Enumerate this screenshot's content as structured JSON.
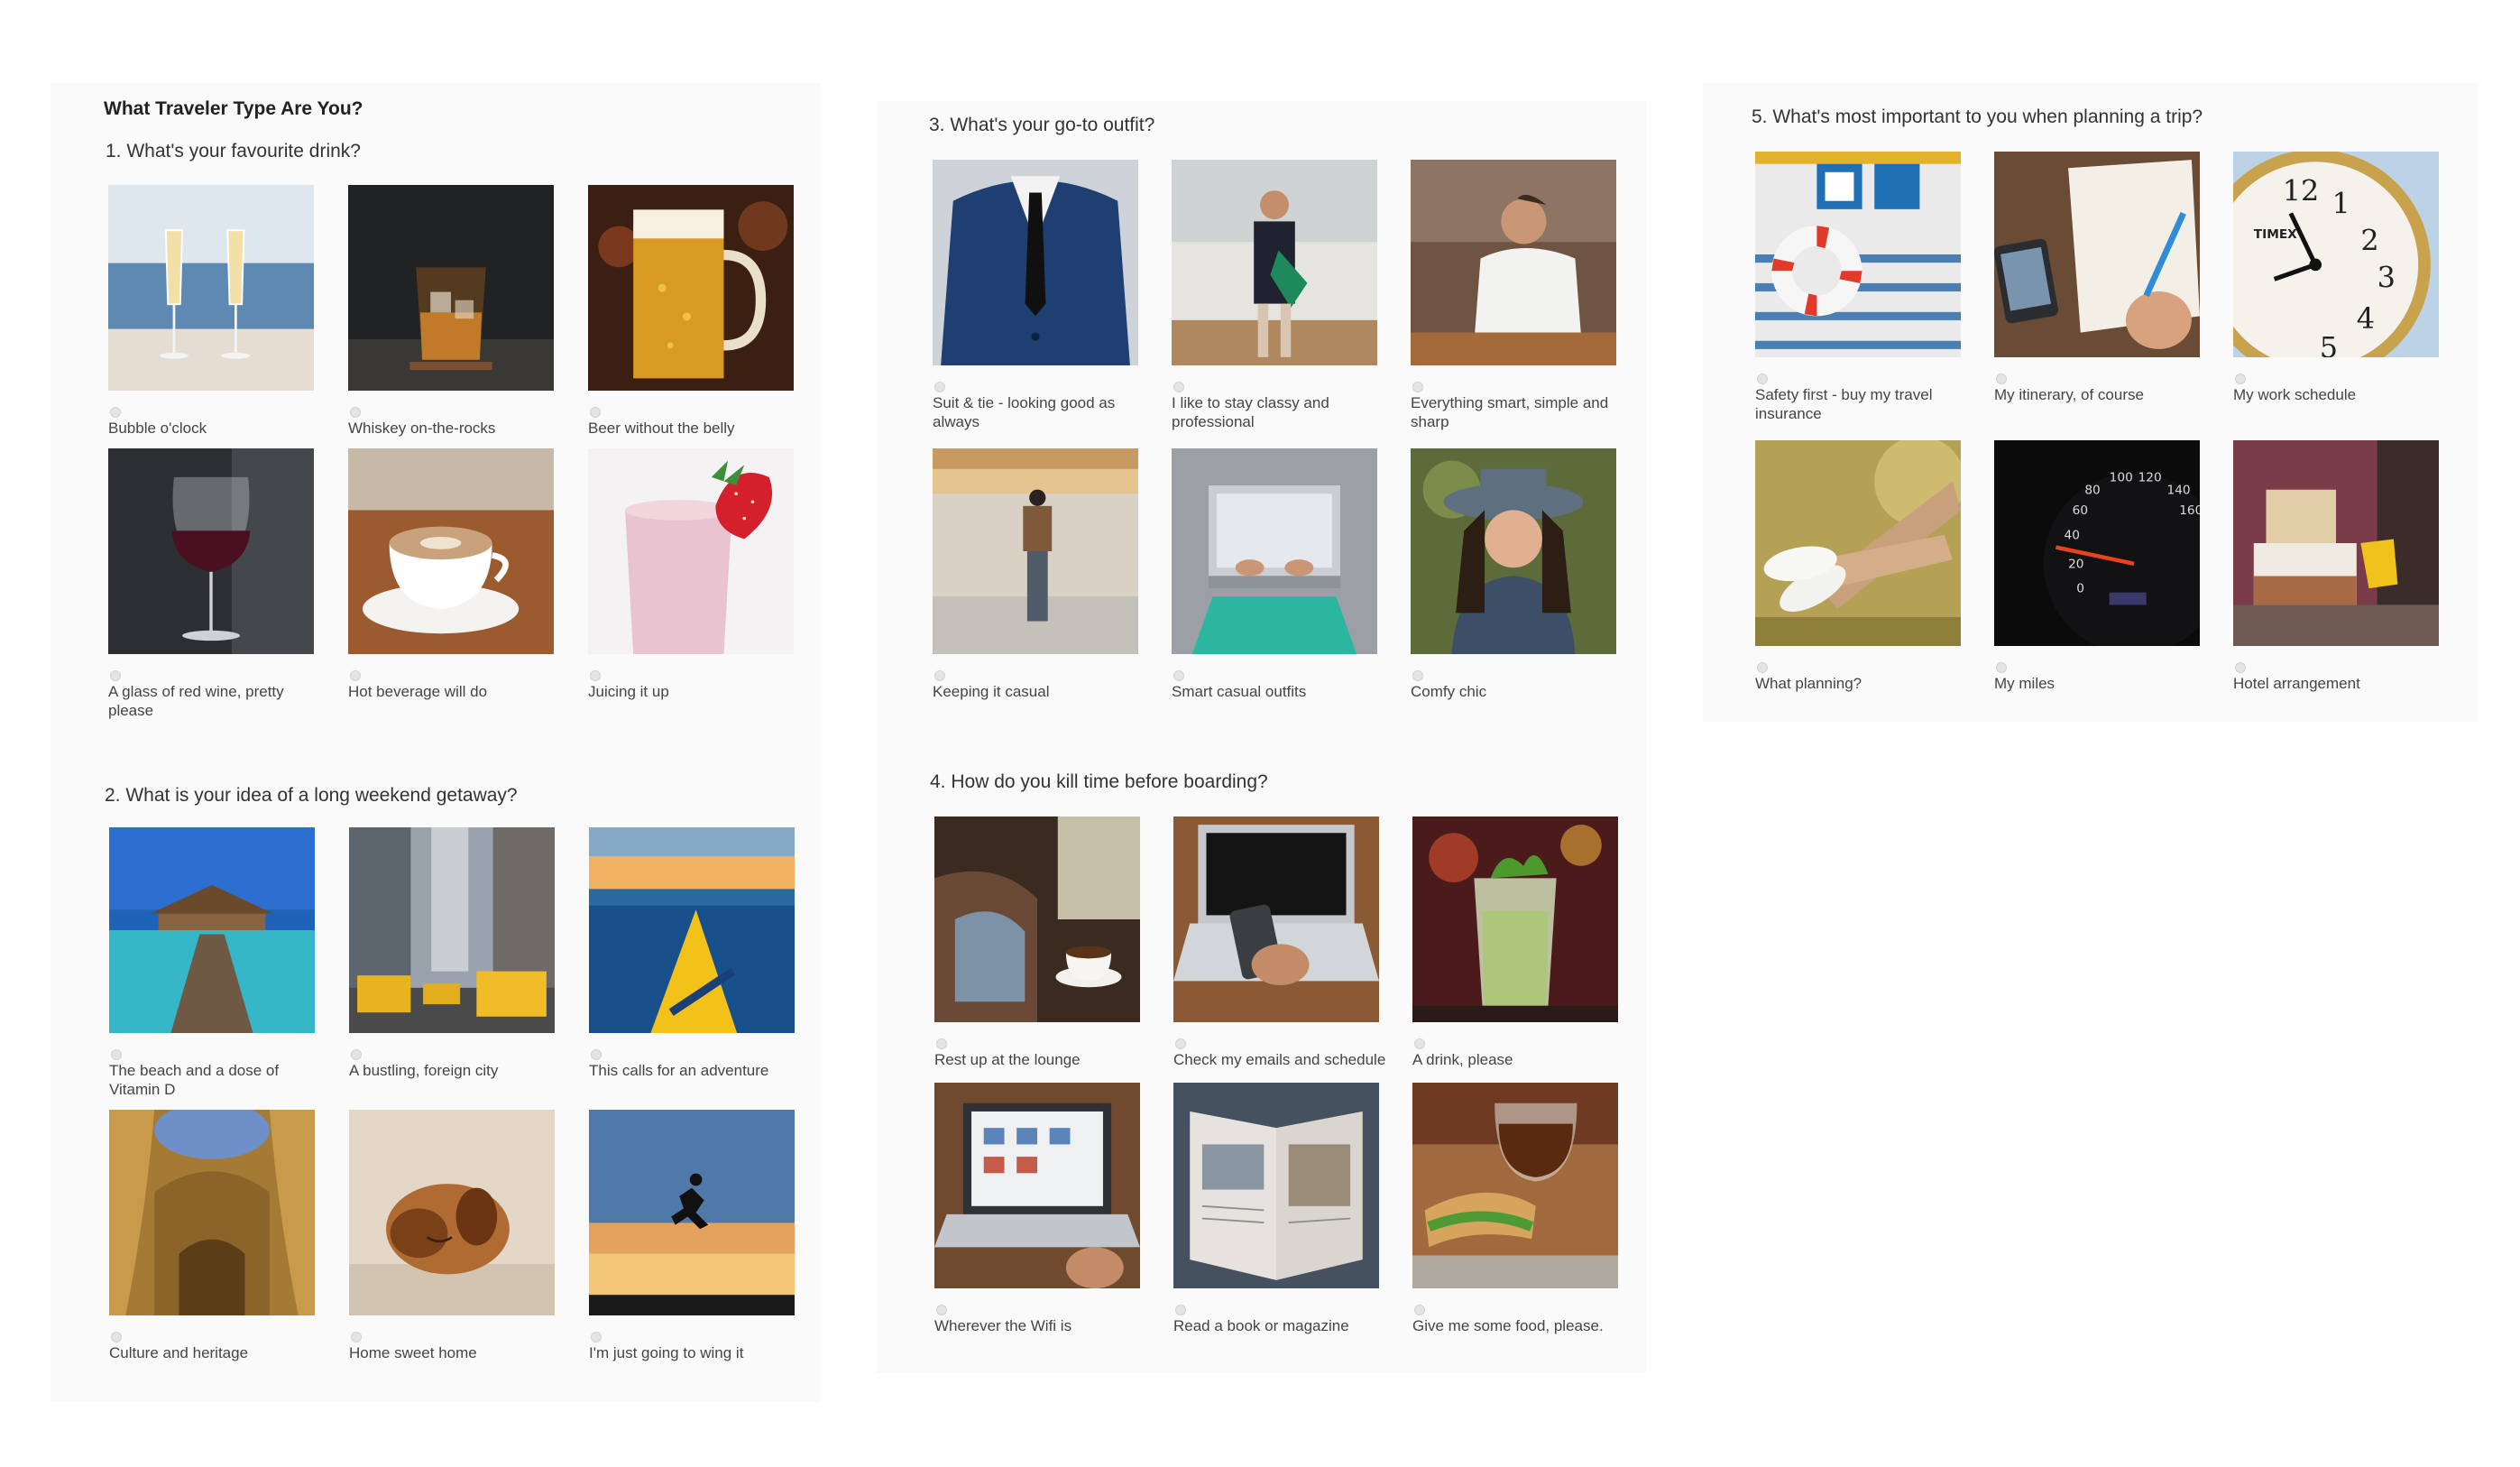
{
  "quiz_title": "What Traveler Type Are You?",
  "questions": [
    {
      "title": "1. What's your favourite drink?",
      "options": [
        {
          "label": "Bubble o'clock",
          "image": "champagne-glasses-photo"
        },
        {
          "label": "Whiskey on-the-rocks",
          "image": "whiskey-glass-photo"
        },
        {
          "label": "Beer without the belly",
          "image": "beer-mug-photo"
        },
        {
          "label": "A glass of red wine, pretty please",
          "image": "red-wine-glass-photo"
        },
        {
          "label": "Hot beverage will do",
          "image": "coffee-cup-photo"
        },
        {
          "label": "Juicing it up",
          "image": "strawberry-smoothie-photo"
        }
      ]
    },
    {
      "title": "2. What is your idea of a long weekend getaway?",
      "options": [
        {
          "label": "The beach and a dose of Vitamin D",
          "image": "beach-bungalow-photo"
        },
        {
          "label": "A bustling, foreign city",
          "image": "city-street-photo"
        },
        {
          "label": "This calls for an adventure",
          "image": "kayak-sea-photo"
        },
        {
          "label": "Culture and heritage",
          "image": "dome-architecture-photo"
        },
        {
          "label": "Home sweet home",
          "image": "sleeping-puppy-photo"
        },
        {
          "label": "I'm just going to wing it",
          "image": "jumping-silhouette-photo"
        }
      ]
    },
    {
      "title": "3. What's your go-to outfit?",
      "options": [
        {
          "label": "Suit & tie - looking good as always",
          "image": "suit-and-tie-photo"
        },
        {
          "label": "I like to stay classy and professional",
          "image": "businesswoman-photo"
        },
        {
          "label": "Everything smart, simple and sharp",
          "image": "man-white-shirt-photo"
        },
        {
          "label": "Keeping it casual",
          "image": "backpacker-photo"
        },
        {
          "label": "Smart casual outfits",
          "image": "laptop-lap-photo"
        },
        {
          "label": "Comfy chic",
          "image": "laughing-woman-hat-photo"
        }
      ]
    },
    {
      "title": "4. How do you kill time before boarding?",
      "options": [
        {
          "label": "Rest up at the lounge",
          "image": "lounge-chair-coffee-photo"
        },
        {
          "label": "Check my emails and schedule",
          "image": "phone-laptop-photo"
        },
        {
          "label": "A drink, please",
          "image": "mojito-photo"
        },
        {
          "label": "Wherever the Wifi is",
          "image": "laptop-browsing-photo"
        },
        {
          "label": "Read a book or magazine",
          "image": "magazine-photo"
        },
        {
          "label": "Give me some food, please.",
          "image": "tea-and-sandwich-photo"
        }
      ]
    },
    {
      "title": "5. What's most important to you when planning a trip?",
      "options": [
        {
          "label": "Safety first - buy my travel insurance",
          "image": "lifebuoy-photo"
        },
        {
          "label": "My itinerary, of course",
          "image": "notebook-writing-photo"
        },
        {
          "label": "My work schedule",
          "image": "alarm-clock-photo"
        },
        {
          "label": "What planning?",
          "image": "relaxing-sneakers-photo"
        },
        {
          "label": "My miles",
          "image": "speedometer-photo"
        },
        {
          "label": "Hotel arrangement",
          "image": "hotel-room-photo"
        }
      ]
    }
  ],
  "clock_brand": "TIMEX",
  "colors": {
    "panel_bg": "#fafafa",
    "text": "#333333",
    "radio": "#e4e4e4"
  }
}
